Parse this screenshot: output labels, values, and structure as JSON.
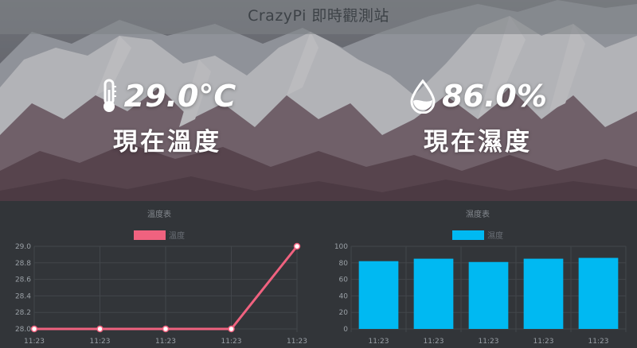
{
  "header": {
    "title": "CrazyPi 即時觀測站"
  },
  "temperature": {
    "value": "29.0°C",
    "label": "現在溫度",
    "icon": "thermometer-icon"
  },
  "humidity": {
    "value": "86.0%",
    "label": "現在濕度",
    "icon": "water-drop-icon"
  },
  "colors": {
    "temp_series": "#f0627f",
    "hum_series": "#00b9f2",
    "background": "#323539"
  },
  "chart_data": [
    {
      "type": "line",
      "title": "溫度表",
      "series": [
        {
          "name": "溫度",
          "values": [
            28.0,
            28.0,
            28.0,
            28.0,
            29.0
          ]
        }
      ],
      "categories": [
        "11:23",
        "11:23",
        "11:23",
        "11:23",
        "11:23"
      ],
      "ylim": [
        28.0,
        29.0
      ],
      "yticks": [
        "29.0",
        "28.8",
        "28.6",
        "28.4",
        "28.2",
        "28.0"
      ],
      "grid": true,
      "legend": "top"
    },
    {
      "type": "bar",
      "title": "濕度表",
      "series": [
        {
          "name": "濕度",
          "values": [
            82,
            85,
            81,
            85,
            86
          ]
        }
      ],
      "categories": [
        "11:23",
        "11:23",
        "11:23",
        "11:23",
        "11:23"
      ],
      "ylim": [
        0,
        100
      ],
      "yticks": [
        "100",
        "80",
        "60",
        "40",
        "20",
        "0"
      ],
      "grid": true,
      "legend": "top"
    }
  ]
}
